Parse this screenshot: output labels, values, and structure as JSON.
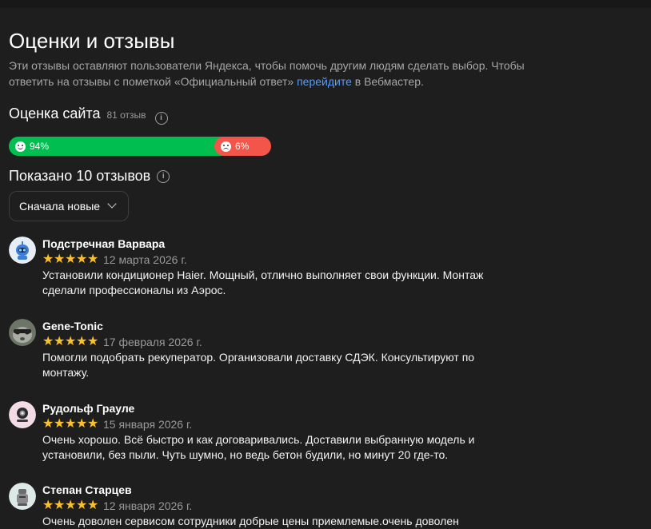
{
  "title": "Оценки и отзывы",
  "intro": {
    "text_before": "Эти отзывы оставляют пользователи Яндекса, чтобы помочь другим людям сделать выбор. Чтобы ответить на отзывы с пометкой «Официальный ответ» ",
    "link": "перейдите",
    "text_after": " в Вебмастер."
  },
  "rating": {
    "title": "Оценка сайта",
    "count": "81 отзыв",
    "positive_label": "94%",
    "negative_label": "6%",
    "positive_fraction": 0.82,
    "positive_color": "#00bf50",
    "negative_color": "#f4554a"
  },
  "shown": {
    "title": "Показано 10 отзывов"
  },
  "sort": {
    "label": "Сначала новые"
  },
  "reviews": [
    {
      "name": "Подстречная Варвара",
      "stars": 5,
      "date": "12 марта 2026 г.",
      "text": "Установили кондиционер Haier. Мощный, отлично выполняет свои функции. Монтаж сделали профессионалы из Аэрос."
    },
    {
      "name": "Gene-Tonic",
      "stars": 5,
      "date": "17 февраля 2026 г.",
      "text": "Помогли подобрать рекуператор. Организовали доставку СДЭК. Консультируют по монтажу."
    },
    {
      "name": "Рудольф Грауле",
      "stars": 5,
      "date": "15 января 2026 г.",
      "text": "Очень хорошо.  Всё быстро и как договаривались. Доставили выбранную модель и установили, без пыли. Чуть шумно,  но ведь бетон будили, но минут 20 где-то."
    },
    {
      "name": "Степан Старцев",
      "stars": 5,
      "date": "12 января 2026 г.",
      "text": "Очень доволен сервисом сотрудники добрые цены приемлемые.очень доволен"
    }
  ],
  "icons": {
    "info": "info-icon",
    "star": "star-icon",
    "chevron": "chevron-down-icon",
    "happy": "happy-face-icon",
    "sad": "sad-face-icon"
  }
}
